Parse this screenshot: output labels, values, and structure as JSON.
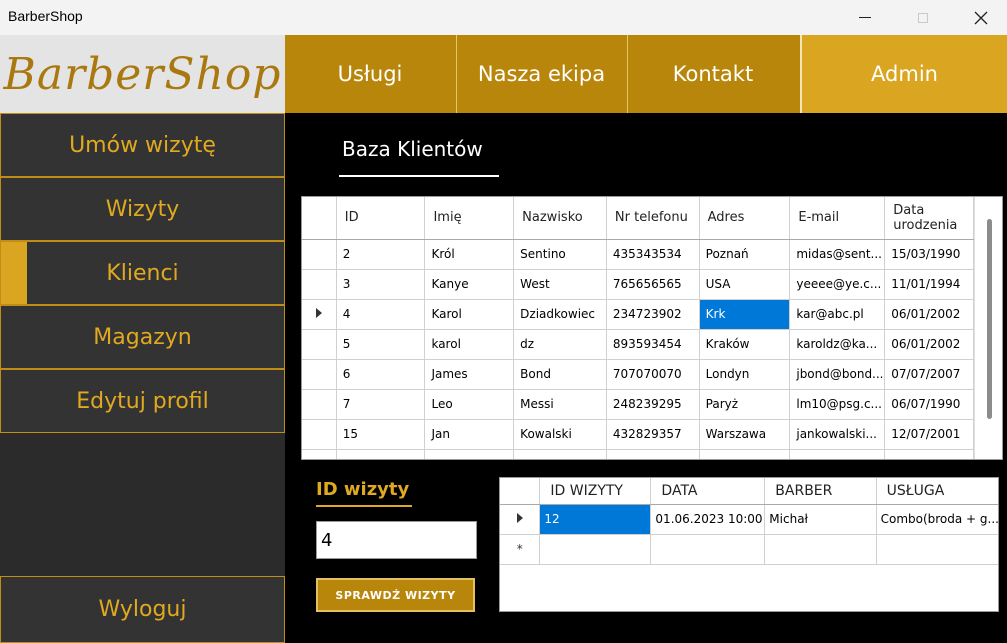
{
  "window": {
    "title": "BarberShop"
  },
  "logo": {
    "text": "BarberShop"
  },
  "topnav": {
    "uslugi": "Usługi",
    "ekipa": "Nasza ekipa",
    "kontakt": "Kontakt",
    "admin": "Admin"
  },
  "sidebar": {
    "items": [
      {
        "label": "Umów wizytę"
      },
      {
        "label": "Wizyty"
      },
      {
        "label": "Klienci",
        "active": true
      },
      {
        "label": "Magazyn"
      },
      {
        "label": "Edytuj profil"
      }
    ],
    "logout": "Wyloguj"
  },
  "main": {
    "title": "Baza Klientów"
  },
  "clients_grid": {
    "columns": [
      "ID",
      "Imię",
      "Nazwisko",
      "Nr telefonu",
      "Adres",
      "E-mail",
      "Data urodzenia"
    ],
    "rows": [
      [
        "2",
        "Król",
        "Sentino",
        "435343534",
        "Poznań",
        "midas@sent...",
        "15/03/1990"
      ],
      [
        "3",
        "Kanye",
        "West",
        "765656565",
        "USA",
        "yeeee@ye.c...",
        "11/01/1994"
      ],
      [
        "4",
        "Karol",
        "Dziadkowiec",
        "234723902",
        "Krk",
        "kar@abc.pl",
        "06/01/2002"
      ],
      [
        "5",
        "karol",
        "dz",
        "893593454",
        "Kraków",
        "karoldz@ka...",
        "06/01/2002"
      ],
      [
        "6",
        "James",
        "Bond",
        "707070070",
        "Londyn",
        "jbond@bond...",
        "07/07/2007"
      ],
      [
        "7",
        "Leo",
        "Messi",
        "248239295",
        "Paryż",
        "lm10@psg.c...",
        "06/07/1990"
      ],
      [
        "15",
        "Jan",
        "Kowalski",
        "432829357",
        "Warszawa",
        "jankowalski...",
        "12/07/2001"
      ]
    ],
    "current_row_index": 2,
    "selected_cell": {
      "row": 2,
      "col": 4
    }
  },
  "visit_lookup": {
    "label": "ID wizyty",
    "value": "4",
    "button": "SPRAWDŹ WIZYTY"
  },
  "visits_grid": {
    "columns": [
      "ID WIZYTY",
      "DATA",
      "BARBER",
      "USŁUGA"
    ],
    "rows": [
      [
        "12",
        "01.06.2023 10:00",
        "Michał",
        "Combo(broda + g..."
      ]
    ]
  },
  "colors": {
    "gold": "#b8860b",
    "gold_light": "#daa520",
    "selection": "#0078d7"
  }
}
